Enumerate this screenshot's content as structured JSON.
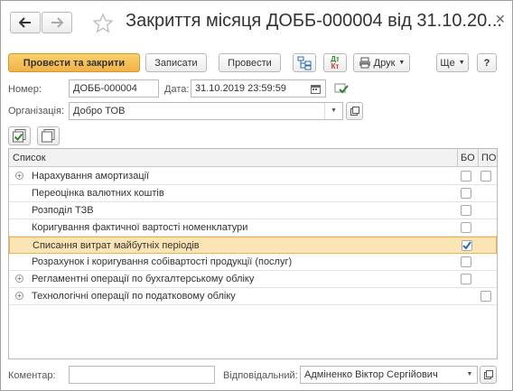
{
  "title": "Закриття місяця ДОББ-000004 від 31.10.20...",
  "toolbar": {
    "post_close": "Провести та закрити",
    "save": "Записати",
    "post": "Провести",
    "dt_kt_top": "Дт",
    "dt_kt_bottom": "Кт",
    "print": "Друк",
    "more": "Ще",
    "help": "?"
  },
  "fields": {
    "number_label": "Номер:",
    "number_value": "ДОББ-000004",
    "date_label": "Дата:",
    "date_value": "31.10.2019 23:59:59",
    "org_label": "Організація:",
    "org_value": "Добро ТОВ",
    "comment_label": "Коментар:",
    "comment_value": "",
    "responsible_label": "Відповідальний:",
    "responsible_value": "Адміненко Віктор Сергійович"
  },
  "table": {
    "col_list": "Список",
    "col_bo": "БО",
    "col_po": "ПО",
    "rows": [
      {
        "label": "Нарахування амортизації",
        "expand": true,
        "bo": false,
        "po": false,
        "show_bo": true,
        "show_po": true
      },
      {
        "label": "Переоцінка валютних коштів",
        "expand": false,
        "bo": false,
        "po": false,
        "show_bo": true,
        "show_po": false
      },
      {
        "label": "Розподіл ТЗВ",
        "expand": false,
        "bo": false,
        "po": false,
        "show_bo": true,
        "show_po": false
      },
      {
        "label": "Коригування фактичної вартості номенклатури",
        "expand": false,
        "bo": false,
        "po": false,
        "show_bo": true,
        "show_po": false
      },
      {
        "label": "Списання витрат майбутніх періодів",
        "expand": false,
        "bo": true,
        "po": false,
        "show_bo": true,
        "show_po": false,
        "selected": true
      },
      {
        "label": "Розрахунок і коригування собівартості продукції (послуг)",
        "expand": false,
        "bo": false,
        "po": false,
        "show_bo": true,
        "show_po": false
      },
      {
        "label": "Регламентні операції по бухгалтерському обліку",
        "expand": true,
        "bo": false,
        "po": false,
        "show_bo": true,
        "show_po": false
      },
      {
        "label": "Технологічні операції по податковому обліку",
        "expand": true,
        "bo": false,
        "po": false,
        "show_bo": false,
        "show_po": true
      }
    ]
  },
  "colors": {
    "accent": "#f0b24a",
    "selected_row": "#fbe5b5",
    "check_blue": "#2b6cb0"
  }
}
